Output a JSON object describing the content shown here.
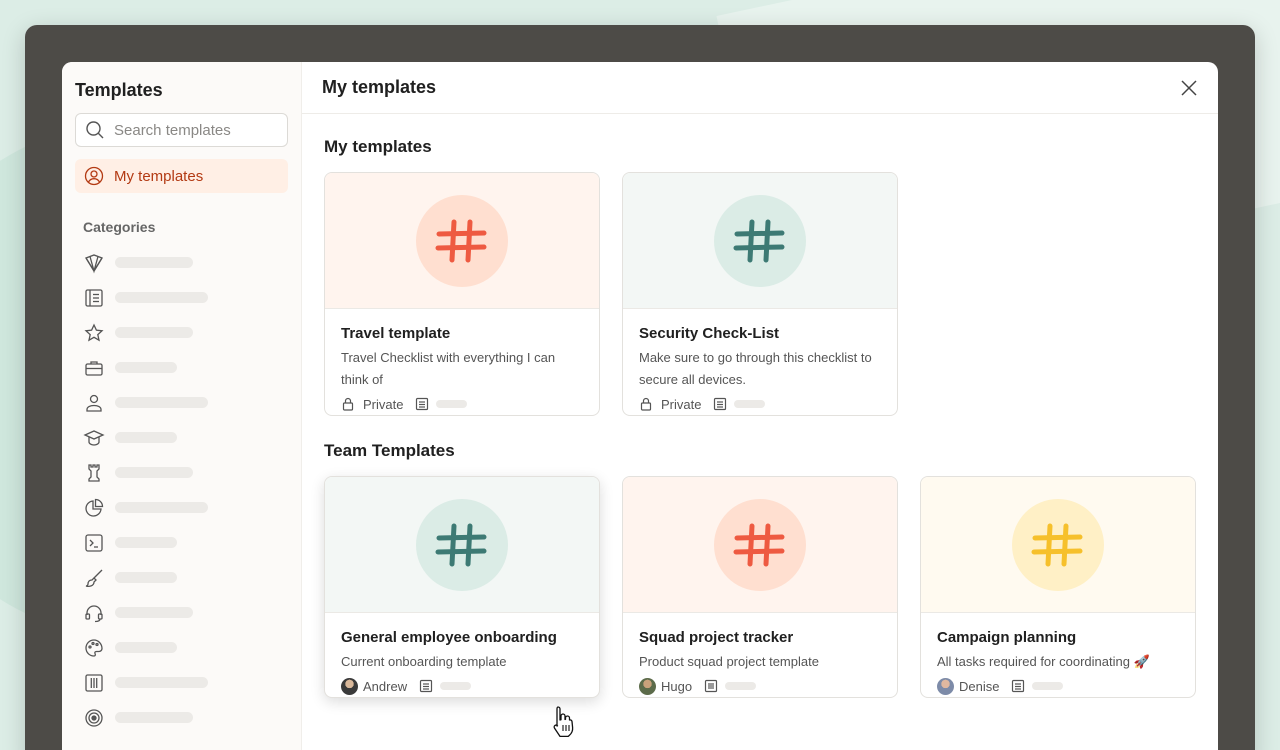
{
  "sidebar": {
    "title": "Templates",
    "search_placeholder": "Search templates",
    "active_item": "My templates",
    "categories_label": "Categories",
    "category_icons": [
      "gem-icon",
      "document-list-icon",
      "star-icon",
      "briefcase-icon",
      "person-icon",
      "graduation-cap-icon",
      "chess-rook-icon",
      "pie-chart-icon",
      "terminal-icon",
      "paintbrush-icon",
      "headset-icon",
      "palette-icon",
      "columns-board-icon",
      "target-icon"
    ]
  },
  "main": {
    "header_title": "My templates",
    "sections": [
      {
        "title": "My templates",
        "cards": [
          {
            "title": "Travel template",
            "description": "Travel Checklist with everything I can think of",
            "owner": "Private",
            "owner_type": "lock",
            "theme": "red",
            "view_icon": "list-view-icon"
          },
          {
            "title": "Security Check-List",
            "description": "Make sure to go through this checklist to secure all devices.",
            "owner": "Private",
            "owner_type": "lock",
            "theme": "teal",
            "view_icon": "list-view-icon"
          }
        ]
      },
      {
        "title": "Team Templates",
        "cards": [
          {
            "title": "General employee onboarding",
            "description": "Current onboarding template",
            "owner": "Andrew",
            "owner_type": "avatar",
            "theme": "teal",
            "view_icon": "list-view-icon"
          },
          {
            "title": "Squad project tracker",
            "description": "Product squad project template",
            "owner": "Hugo",
            "owner_type": "avatar",
            "theme": "red",
            "view_icon": "board-view-icon"
          },
          {
            "title": "Campaign planning",
            "description": "All tasks required for coordinating 🚀",
            "owner": "Denise",
            "owner_type": "avatar",
            "theme": "yellow",
            "view_icon": "list-view-icon"
          }
        ]
      }
    ]
  },
  "colors": {
    "accent": "#dc4c3e",
    "active_bg": "#ffefe5",
    "active_text": "#b33a13",
    "red_hero_bg": "#fff4ee",
    "red_circle": "#ffdfd0",
    "teal_hero_bg": "#f3f7f5",
    "teal_circle": "#dbece6",
    "teal_hash": "#3d7a74",
    "yellow_hero_bg": "#fffaf0",
    "yellow_circle": "#fff0c6",
    "yellow_hash": "#f6c02b"
  }
}
